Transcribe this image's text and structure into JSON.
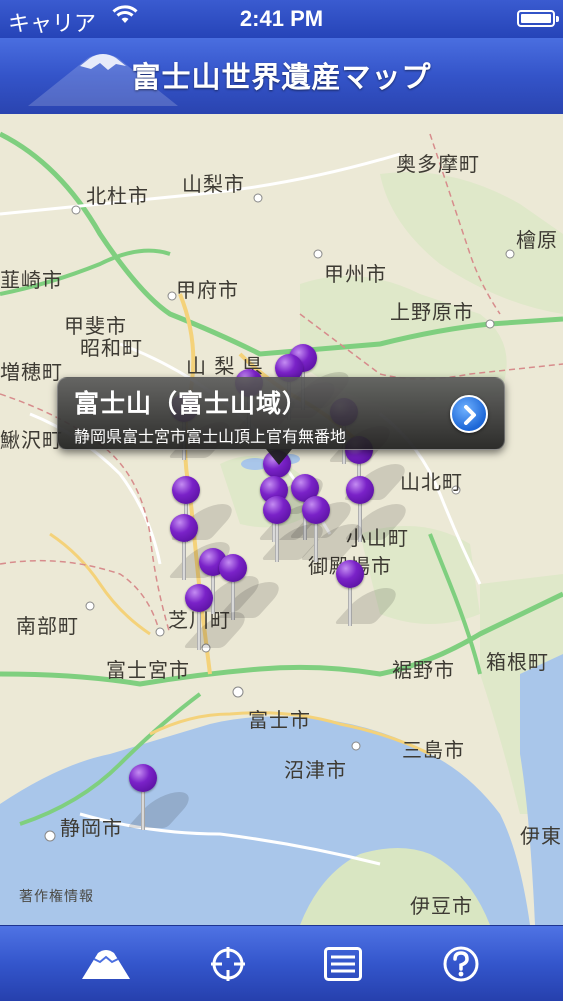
{
  "status_bar": {
    "carrier": "キャリア",
    "time": "2:41 PM"
  },
  "title_bar": {
    "title": "富士山世界遺産マップ"
  },
  "map": {
    "labels": {
      "hokuto": "北杜市",
      "yamanashi_city": "山梨市",
      "okutama": "奥多摩町",
      "hinohara": "檜原",
      "nirasaki": "韮崎市",
      "kofu": "甲府市",
      "koshu": "甲州市",
      "uenohara": "上野原市",
      "kai": "甲斐市",
      "showa": "昭和町",
      "yamanashi_pref": "山 梨 県",
      "masuho": "増穂町",
      "kajikazawa": "鰍沢町",
      "yamakita": "山北町",
      "oyama": "小山町",
      "gotemba": "御殿場市",
      "nambu": "南部町",
      "shibakawa": "芝川町",
      "fujinomiya": "富士宮市",
      "susono": "裾野市",
      "hakone": "箱根町",
      "fuji": "富士市",
      "mishima": "三島市",
      "numazu": "沼津市",
      "shizuoka": "静岡市",
      "izu": "伊豆市",
      "ito": "伊東"
    },
    "legal": "著作権情報"
  },
  "callout": {
    "title": "富士山（富士山域）",
    "address": "静岡県富士宮市富士山頂上官有無番地"
  },
  "tabs": [
    {
      "icon": "mountain-icon"
    },
    {
      "icon": "crosshair-icon"
    },
    {
      "icon": "list-icon"
    },
    {
      "icon": "help-icon"
    }
  ],
  "colors": {
    "bar_blue": "#3454c9",
    "pin_purple": "#7a22c8",
    "sea": "#a9c6ea",
    "land": "#ece9d6",
    "park": "#d9e6c2"
  }
}
